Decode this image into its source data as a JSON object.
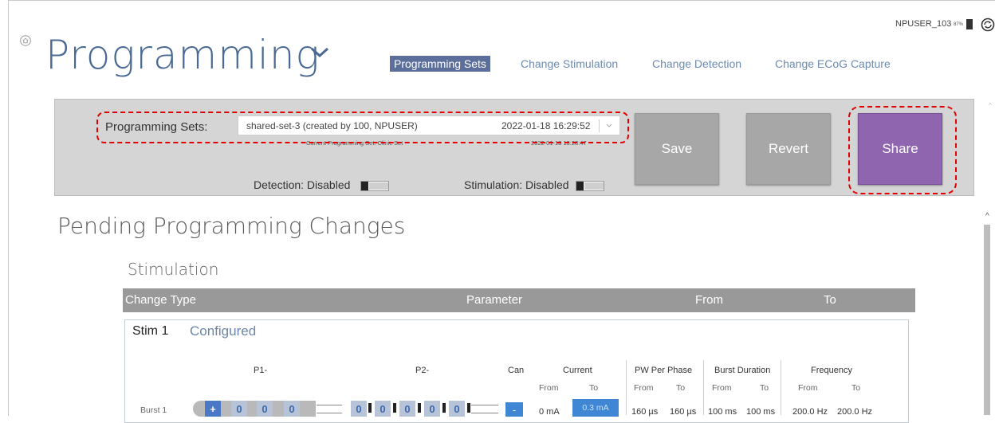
{
  "header": {
    "title": "Programming",
    "tabs": [
      "Programming Sets",
      "Change Stimulation",
      "Change Detection",
      "Change ECoG Capture"
    ],
    "user": "NPUSER_103",
    "battery": "87%"
  },
  "toolbar": {
    "sets_label": "Programming Sets:",
    "selected_set": "shared-set-3 (created by 100, NPUSER)",
    "selected_date": "2022-01-18 16:29:52",
    "current_set": "Current Programming Set: Clinic Set",
    "current_date": "2022-01-18 13:28:47",
    "save": "Save",
    "revert": "Revert",
    "share": "Share",
    "detection": "Detection: Disabled",
    "stimulation": "Stimulation: Disabled"
  },
  "pending": {
    "title": "Pending Programming Changes",
    "section": "Stimulation",
    "columns": [
      "Change Type",
      "Parameter",
      "From",
      "To"
    ]
  },
  "stim": {
    "name": "Stim 1",
    "status": "Configured",
    "p1": "P1-",
    "p2": "P2-",
    "can": "Can",
    "current": "Current",
    "pw": "PW Per Phase",
    "burst_dur": "Burst Duration",
    "frequency": "Frequency",
    "from": "From",
    "to": "To",
    "burst_label": "Burst 1",
    "plus": "+",
    "minus": "-",
    "zero": "0",
    "current_from": "0 mA",
    "current_to": "0.3 mA",
    "pw_from": "160 µs",
    "pw_to": "160 µs",
    "bd_from": "100 ms",
    "bd_to": "100 ms",
    "freq_from": "200.0 Hz",
    "freq_to": "200.0 Hz"
  },
  "colors": {
    "title": "#4a6a94",
    "share": "#8f65b0",
    "highlight": "#e30000",
    "accent_blue": "#3f86d4"
  }
}
